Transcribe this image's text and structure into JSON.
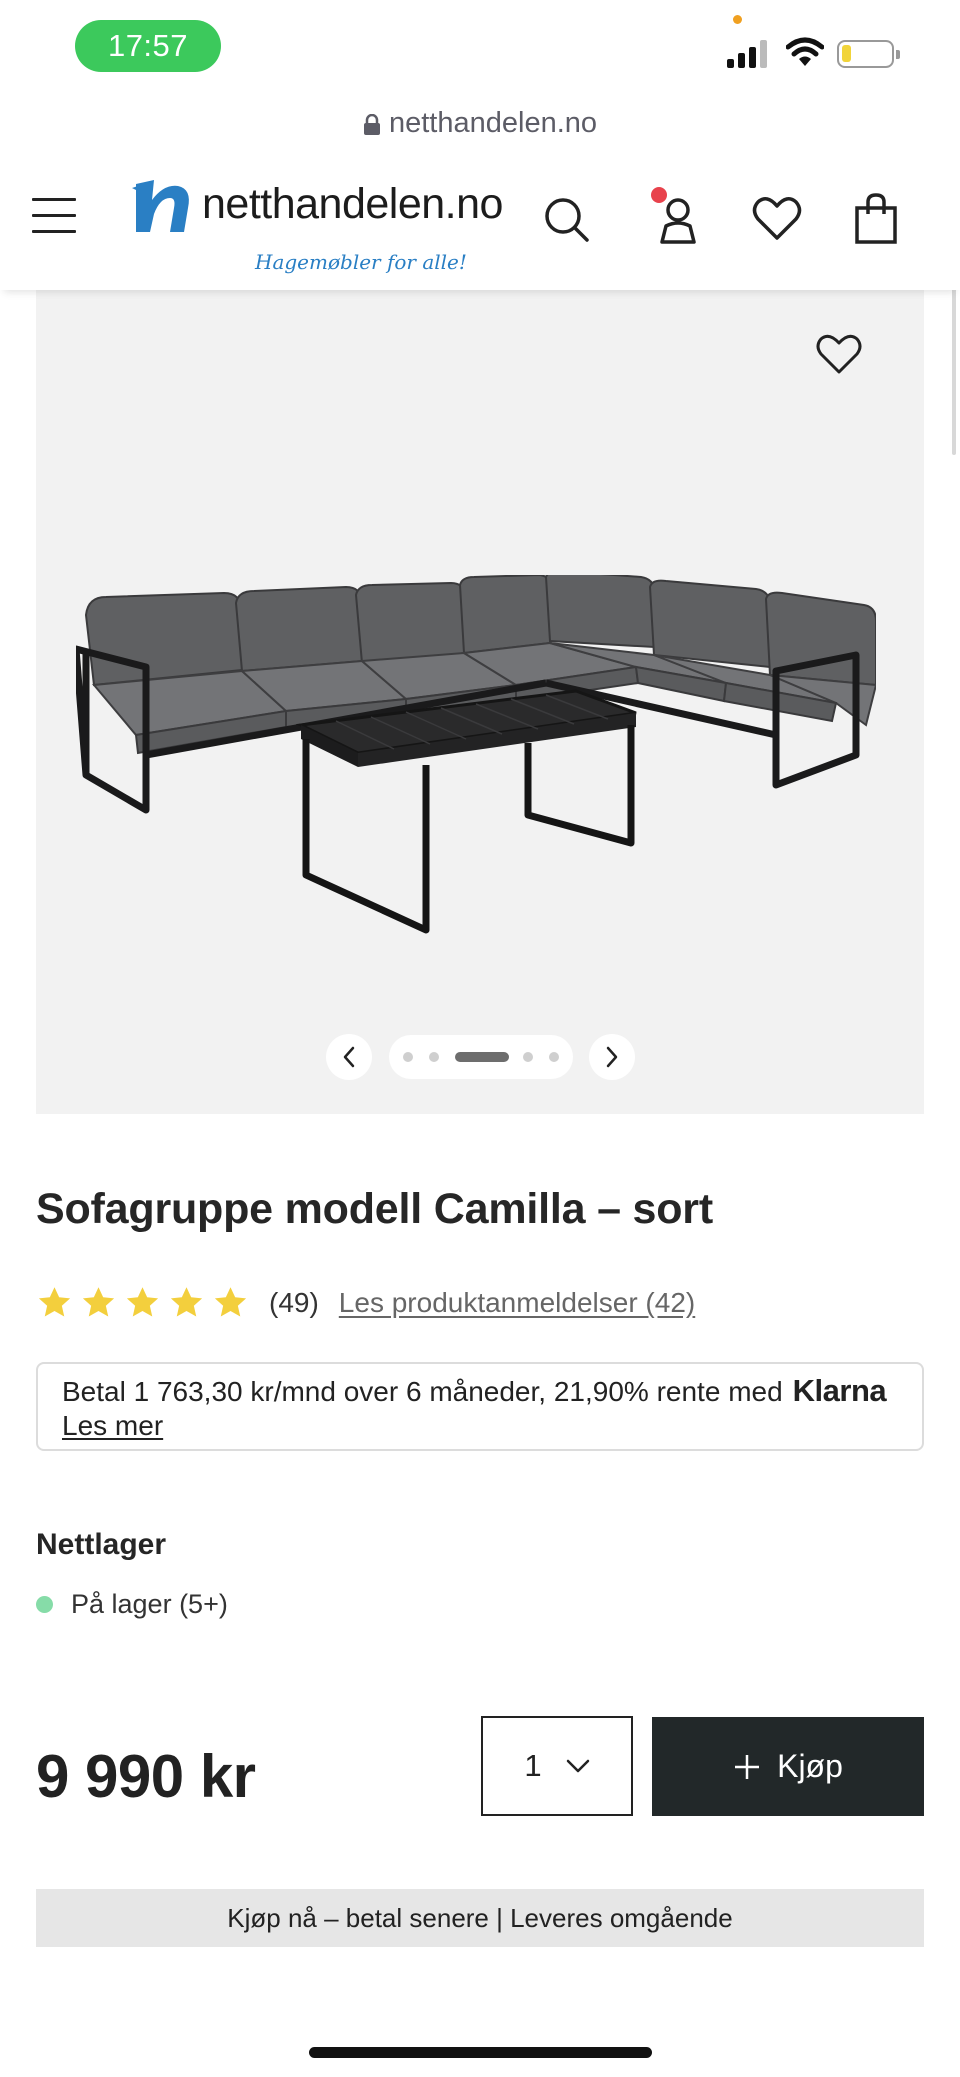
{
  "status_bar": {
    "time": "17:57",
    "battery_level": 0.15
  },
  "browser": {
    "url": "netthandelen.no"
  },
  "header": {
    "logo_text": "netthandelen.no",
    "logo_tagline": "Hagemøbler for alle!",
    "icons": [
      "menu-icon",
      "search-icon",
      "account-icon",
      "wishlist-icon",
      "shopping-bag-icon"
    ],
    "account_notification": true
  },
  "product": {
    "title": "Sofagruppe modell Camilla – sort",
    "rating": {
      "stars": 5,
      "count": "(49)",
      "reviews_link": "Les produktanmeldelser (42)"
    },
    "gallery": {
      "image_count": 5,
      "active_index": 2
    },
    "klarna": {
      "text": "Betal 1 763,30 kr/mnd over 6 måneder, 21,90% rente med",
      "brand": "Klarna",
      "link": "Les mer"
    },
    "stock": {
      "title": "Nettlager",
      "status": "På lager (5+)"
    },
    "price": "9 990 kr",
    "quantity": "1",
    "buy_label": "Kjøp"
  },
  "promo": {
    "text": "Kjøp nå – betal senere | Leveres omgående"
  },
  "colors": {
    "logo_blue": "#2a7fc4",
    "time_pill": "#3cc95c",
    "buy_button": "#222829",
    "stock_dot": "#86dca8",
    "star": "#f3cf3d",
    "notification": "#e8424c"
  }
}
